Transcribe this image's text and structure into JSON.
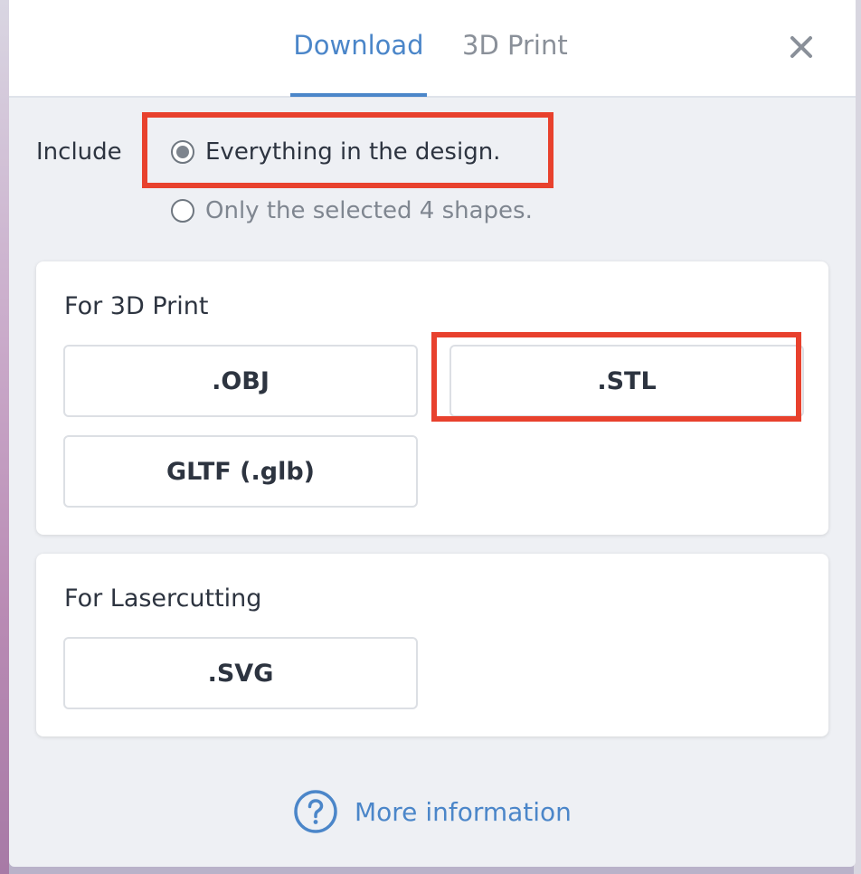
{
  "tabs": [
    {
      "label": "Download",
      "active": true
    },
    {
      "label": "3D Print",
      "active": false
    }
  ],
  "close_icon": "close-icon",
  "include": {
    "label": "Include",
    "options": [
      {
        "label": "Everything in the design.",
        "checked": true
      },
      {
        "label": "Only the selected 4 shapes.",
        "checked": false
      }
    ]
  },
  "print_section": {
    "title": "For 3D Print",
    "buttons": [
      ".OBJ",
      ".STL",
      "GLTF (.glb)"
    ]
  },
  "laser_section": {
    "title": "For Lasercutting",
    "buttons": [
      ".SVG"
    ]
  },
  "more_info": {
    "icon": "help-circle-icon",
    "label": "More information"
  },
  "colors": {
    "accent": "#4b86c9",
    "highlight": "#e8412d",
    "panel_bg": "#eef0f4"
  }
}
